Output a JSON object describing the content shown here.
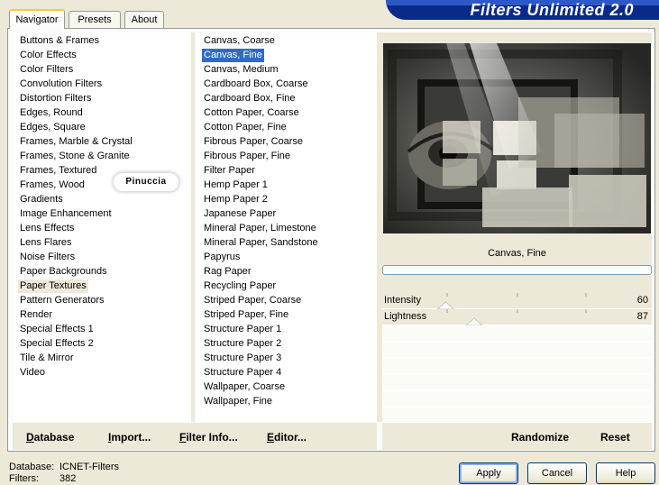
{
  "app": {
    "banner": "Filters Unlimited 2.0"
  },
  "tabs": [
    {
      "label": "Navigator",
      "active": true
    },
    {
      "label": "Presets",
      "active": false
    },
    {
      "label": "About",
      "active": false
    }
  ],
  "categories": {
    "items": [
      "Buttons & Frames",
      "Color Effects",
      "Color Filters",
      "Convolution Filters",
      "Distortion Filters",
      "Edges, Round",
      "Edges, Square",
      "Frames, Marble & Crystal",
      "Frames, Stone & Granite",
      "Frames, Textured",
      "Frames, Wood",
      "Gradients",
      "Image Enhancement",
      "Lens Effects",
      "Lens Flares",
      "Noise Filters",
      "Paper Backgrounds",
      "Paper Textures",
      "Pattern Generators",
      "Render",
      "Special Effects 1",
      "Special Effects 2",
      "Tile & Mirror",
      "Video"
    ],
    "selected": "Paper Textures"
  },
  "watermark": "Pinuccia",
  "filters": {
    "items": [
      "Canvas, Coarse",
      "Canvas, Fine",
      "Canvas, Medium",
      "Cardboard Box, Coarse",
      "Cardboard Box, Fine",
      "Cotton Paper, Coarse",
      "Cotton Paper, Fine",
      "Fibrous Paper, Coarse",
      "Fibrous Paper, Fine",
      "Filter Paper",
      "Hemp Paper 1",
      "Hemp Paper 2",
      "Japanese Paper",
      "Mineral Paper, Limestone",
      "Mineral Paper, Sandstone",
      "Papyrus",
      "Rag Paper",
      "Recycling Paper",
      "Striped Paper, Coarse",
      "Striped Paper, Fine",
      "Structure Paper 1",
      "Structure Paper 2",
      "Structure Paper 3",
      "Structure Paper 4",
      "Wallpaper, Coarse",
      "Wallpaper, Fine"
    ],
    "selected": "Canvas, Fine"
  },
  "preview": {
    "filter_name": "Canvas, Fine",
    "progress": 0
  },
  "sliders": [
    {
      "label": "Intensity",
      "value": "60",
      "level": 60
    },
    {
      "label": "Lightness",
      "value": "87",
      "level": 87
    }
  ],
  "bottom_links": {
    "database": {
      "label": "Database",
      "underline": "D"
    },
    "import": {
      "label": "Import...",
      "underline": "I"
    },
    "filter_info": {
      "label": "Filter Info...",
      "underline": "F"
    },
    "editor": {
      "label": "Editor...",
      "underline": "E"
    },
    "randomize": "Randomize",
    "reset": "Reset"
  },
  "status": {
    "database_label": "Database:",
    "database_value": "ICNET-Filters",
    "filters_label": "Filters:",
    "filters_value": "382"
  },
  "buttons": {
    "apply": "Apply",
    "cancel": "Cancel",
    "help": "Help"
  },
  "colors": {
    "banner": "#0a2a8a",
    "selection": "#316ac5",
    "face": "#ece9d8"
  }
}
